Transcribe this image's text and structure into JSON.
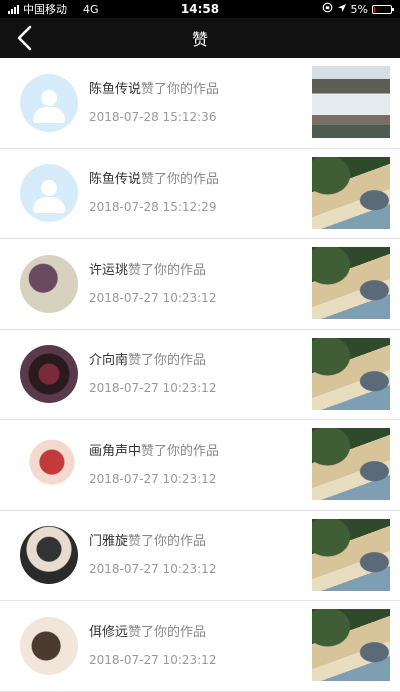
{
  "status_bar": {
    "carrier": "中国移动",
    "network": "4G",
    "time": "14:58",
    "battery": "5%",
    "battery_level": 0.05
  },
  "nav": {
    "title": "赞"
  },
  "action_text": "赞了你的作品",
  "items": [
    {
      "name": "陈鱼传说",
      "time": "2018-07-28 15:12:36",
      "avatar": "default-avatar-icon",
      "thumb": "sea"
    },
    {
      "name": "陈鱼传说",
      "time": "2018-07-28 15:12:29",
      "avatar": "default-avatar-icon",
      "thumb": "beach"
    },
    {
      "name": "许运珧",
      "time": "2018-07-27 10:23:12",
      "avatar": "photo",
      "thumb": "beach"
    },
    {
      "name": "介向南",
      "time": "2018-07-27 10:23:12",
      "avatar": "photo",
      "thumb": "beach"
    },
    {
      "name": "画角声中",
      "time": "2018-07-27 10:23:12",
      "avatar": "photo",
      "thumb": "beach"
    },
    {
      "name": "门雅旋",
      "time": "2018-07-27 10:23:12",
      "avatar": "photo",
      "thumb": "beach"
    },
    {
      "name": "佴修远",
      "time": "2018-07-27 10:23:12",
      "avatar": "photo",
      "thumb": "beach"
    }
  ]
}
